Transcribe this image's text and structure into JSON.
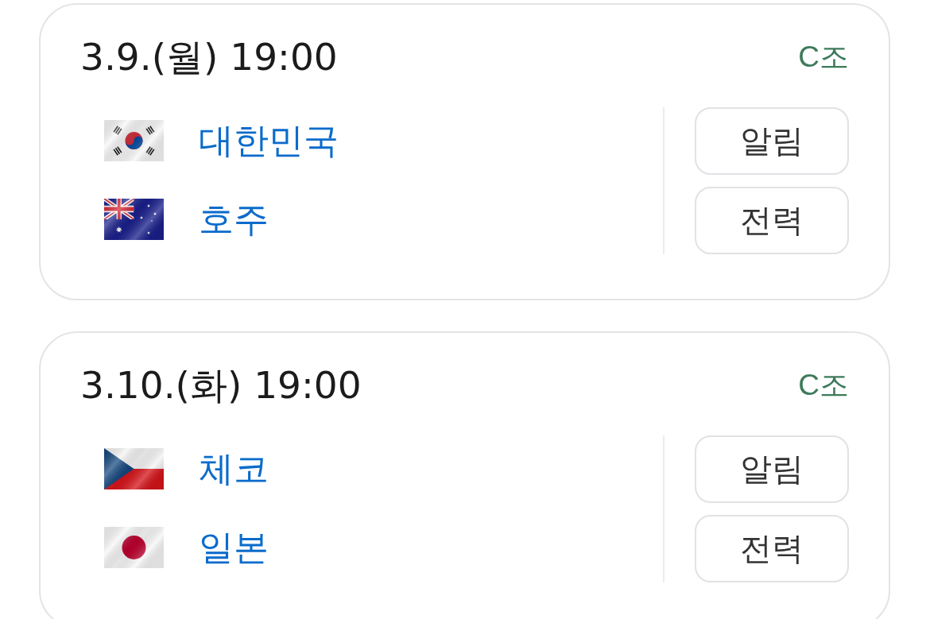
{
  "matches": [
    {
      "datetime": "3.9.(월) 19:00",
      "group": "C조",
      "teams": [
        {
          "kind": "korea",
          "name": "대한민국"
        },
        {
          "kind": "australia",
          "name": "호주"
        }
      ],
      "buttons": [
        "알림",
        "전력"
      ]
    },
    {
      "datetime": "3.10.(화) 19:00",
      "group": "C조",
      "teams": [
        {
          "kind": "czechia",
          "name": "체코"
        },
        {
          "kind": "japan",
          "name": "일본"
        }
      ],
      "buttons": [
        "알림",
        "전력"
      ]
    }
  ]
}
